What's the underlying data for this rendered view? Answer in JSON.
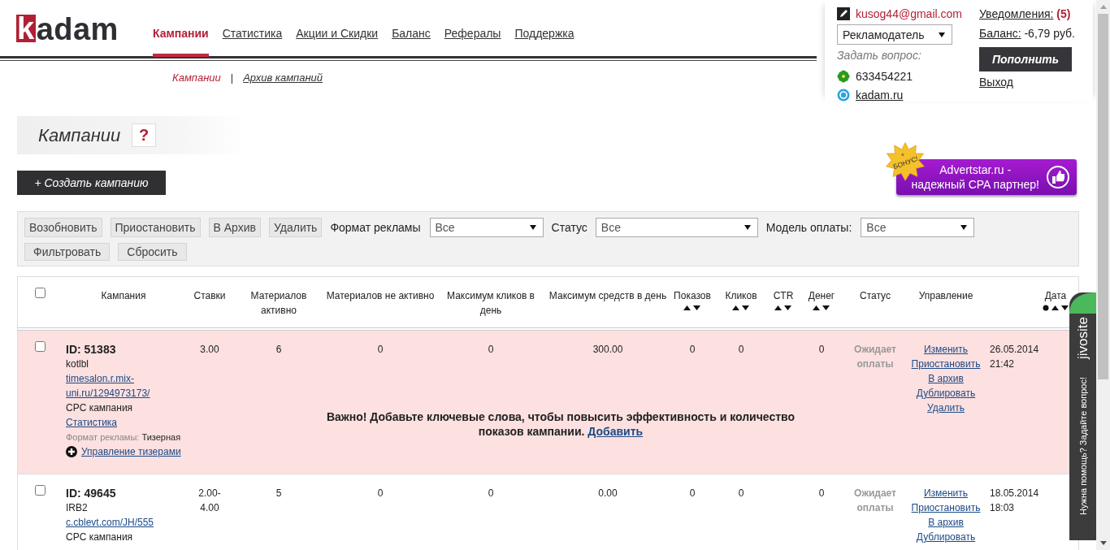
{
  "logo": {
    "mark": "k",
    "text": "adam"
  },
  "nav": [
    {
      "label": "Кампании",
      "selected": true
    },
    {
      "label": "Статистика",
      "selected": false
    },
    {
      "label": "Акции и Скидки",
      "selected": false
    },
    {
      "label": "Баланс",
      "selected": false
    },
    {
      "label": "Рефералы",
      "selected": false
    },
    {
      "label": "Поддержка",
      "selected": false
    }
  ],
  "subnav": {
    "separator": "|",
    "items": [
      {
        "label": "Кампании",
        "selected": true
      },
      {
        "label": "Архив кампаний",
        "selected": false
      }
    ]
  },
  "account": {
    "email": "kusog44@gmail.com",
    "role": "Рекламодатель",
    "ask_label": "Задать вопрос:",
    "icq": "633454221",
    "skype": "kadam.ru",
    "notifications_label": "Уведомления:",
    "notifications_count": "(5)",
    "balance_label": "Баланс:",
    "balance_value": "-6,79 руб.",
    "topup_button": "Пополнить",
    "logout": "Выход"
  },
  "page_title": "Кампании",
  "help_button": "?",
  "create_button": "+ Создать кампанию",
  "banner": {
    "badge_plus": "+",
    "badge_text": "БОНУС!",
    "line1": "Advertstar.ru -",
    "line2": "надежный CPA партнер!"
  },
  "filters": {
    "actions": [
      "Возобновить",
      "Приостановить",
      "В Архив",
      "Удалить"
    ],
    "format_label": "Формат рекламы",
    "format_value": "Все",
    "status_label": "Статус",
    "status_value": "Все",
    "payment_label": "Модель оплаты:",
    "payment_value": "Все",
    "filter_button": "Фильтровать",
    "reset_button": "Сбросить"
  },
  "table": {
    "select_all_checked": false,
    "columns": [
      {
        "label": "Кампания",
        "sortable": false
      },
      {
        "label": "Ставки",
        "sortable": false
      },
      {
        "label": "Материалов активно",
        "sortable": false
      },
      {
        "label": "Материалов не активно",
        "sortable": false
      },
      {
        "label": "Максимум кликов в день",
        "sortable": false
      },
      {
        "label": "Максимум средств в день",
        "sortable": false
      },
      {
        "label": "Показов",
        "sortable": true,
        "sorted": false
      },
      {
        "label": "Кликов",
        "sortable": true,
        "sorted": false
      },
      {
        "label": "CTR",
        "sortable": true,
        "sorted": false
      },
      {
        "label": "Денег",
        "sortable": true,
        "sorted": false
      },
      {
        "label": "Статус",
        "sortable": false
      },
      {
        "label": "Управление",
        "sortable": false
      },
      {
        "label": "Дата",
        "sortable": true,
        "sorted": true
      }
    ],
    "rows": [
      {
        "checked": false,
        "highlighted": true,
        "id": "ID: 51383",
        "name": "kotlbl",
        "url": "timesalon.r.mix-uni.ru/1294973173/",
        "type": "CPC кампания",
        "stats_link": "Статистика",
        "format_label": "Формат рекламы:",
        "format_value": "Тизерная",
        "teasers_link": "Управление тизерами",
        "bids": "3.00",
        "active": "6",
        "inactive": "0",
        "max_clicks": "0",
        "max_budget": "300.00",
        "impressions": "0",
        "clicks": "0",
        "money": "0",
        "status": "Ожидает оплаты",
        "actions": [
          "Изменить",
          "Приостановить",
          "В архив",
          "Дублировать",
          "Удалить"
        ],
        "date": "26.05.2014",
        "time": "21:42",
        "notice": {
          "text": "Важно! Добавьте ключевые слова, чтобы повысить эффективность и количество показов кампании.",
          "link": "Добавить"
        }
      },
      {
        "checked": false,
        "highlighted": false,
        "id": "ID: 49645",
        "name": "IRB2",
        "url": "c.cblevt.com/JH/555",
        "type": "CPC кампания",
        "bids": "2.00-4.00",
        "active": "5",
        "inactive": "0",
        "max_clicks": "0",
        "max_budget": "0.00",
        "impressions": "0",
        "clicks": "0",
        "money": "0",
        "status": "Ожидает оплаты",
        "actions": [
          "Изменить",
          "Приостановить",
          "В архив",
          "Дублировать"
        ],
        "date": "18.05.2014",
        "time": "18:03"
      }
    ]
  },
  "chat_widget": {
    "brand": "jivosite",
    "prompt": "Нужна помощь? Задайте вопрос!"
  }
}
